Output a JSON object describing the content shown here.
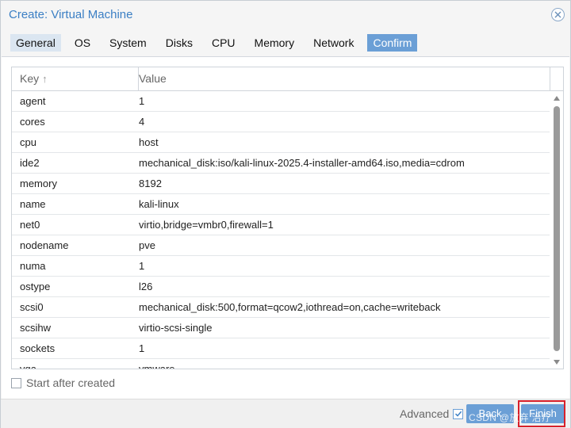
{
  "window": {
    "title": "Create: Virtual Machine"
  },
  "tabs": [
    {
      "label": "General"
    },
    {
      "label": "OS"
    },
    {
      "label": "System"
    },
    {
      "label": "Disks"
    },
    {
      "label": "CPU"
    },
    {
      "label": "Memory"
    },
    {
      "label": "Network"
    },
    {
      "label": "Confirm"
    }
  ],
  "grid": {
    "headers": {
      "key": "Key",
      "value": "Value"
    },
    "rows": [
      {
        "key": "agent",
        "value": "1"
      },
      {
        "key": "cores",
        "value": "4"
      },
      {
        "key": "cpu",
        "value": "host"
      },
      {
        "key": "ide2",
        "value": "mechanical_disk:iso/kali-linux-2025.4-installer-amd64.iso,media=cdrom"
      },
      {
        "key": "memory",
        "value": "8192"
      },
      {
        "key": "name",
        "value": "kali-linux"
      },
      {
        "key": "net0",
        "value": "virtio,bridge=vmbr0,firewall=1"
      },
      {
        "key": "nodename",
        "value": "pve"
      },
      {
        "key": "numa",
        "value": "1"
      },
      {
        "key": "ostype",
        "value": "l26"
      },
      {
        "key": "scsi0",
        "value": "mechanical_disk:500,format=qcow2,iothread=on,cache=writeback"
      },
      {
        "key": "scsihw",
        "value": "virtio-scsi-single"
      },
      {
        "key": "sockets",
        "value": "1"
      },
      {
        "key": "vga",
        "value": "vmware"
      }
    ]
  },
  "options": {
    "start_after_created": "Start after created",
    "start_checked": false
  },
  "footer": {
    "advanced_label": "Advanced",
    "advanced_checked": true,
    "back_label": "Back",
    "finish_label": "Finish",
    "watermark": "CSDN @放弃 治疗"
  },
  "colors": {
    "accent": "#3b7fc4",
    "button": "#6b9fd6",
    "highlight": "#d8202a"
  },
  "icons": {
    "close": "close-circle-icon",
    "sort": "sort-ascending-icon",
    "check": "checkmark-icon"
  }
}
